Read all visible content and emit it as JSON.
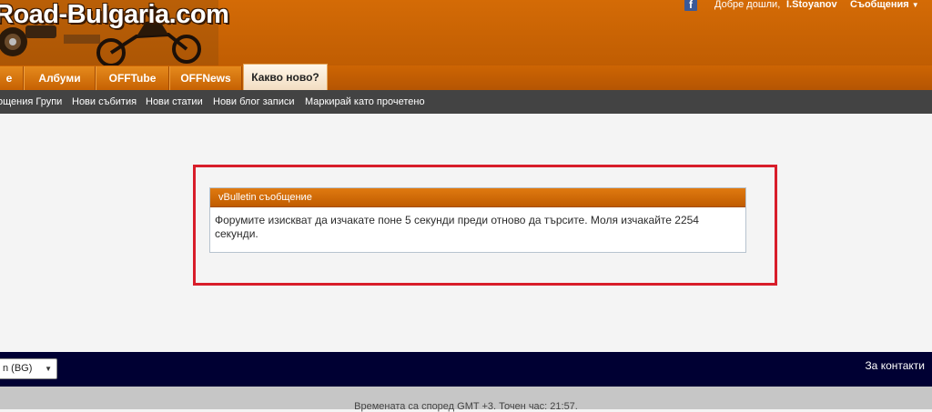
{
  "header": {
    "logo_text": "Road-Bulgaria.com",
    "welcome_text": "Добре дошли,",
    "username": "I.Stoyanov",
    "messages_label": "Съобщения",
    "facebook_icon": "facebook-icon"
  },
  "nav": {
    "tabs": [
      {
        "label": "е"
      },
      {
        "label": "Албуми"
      },
      {
        "label": "OFFTube"
      },
      {
        "label": "OFFNews"
      },
      {
        "label": "Какво ново?"
      }
    ],
    "active_tab": "Какво ново?"
  },
  "subnav": {
    "links": [
      {
        "label": "ощения Групи"
      },
      {
        "label": "Нови събития"
      },
      {
        "label": "Нови статии"
      },
      {
        "label": "Нови блог записи"
      },
      {
        "label": "Маркирай като прочетено"
      }
    ]
  },
  "message": {
    "title": "vBulletin съобщение",
    "body": "Форумите изискват да изчакате поне 5 секунди преди отново да търсите. Моля изчакайте 2254 секунди."
  },
  "footer": {
    "language_selected": "n (BG)",
    "contact_label": "За контакти",
    "timezone_text": "Времената са според GMT +3. Точен час: 21:57."
  },
  "colors": {
    "header_orange": "#d46b06",
    "subnav_gray": "#434343",
    "footer_navy": "#000033",
    "highlight_red": "#d81d2a"
  }
}
